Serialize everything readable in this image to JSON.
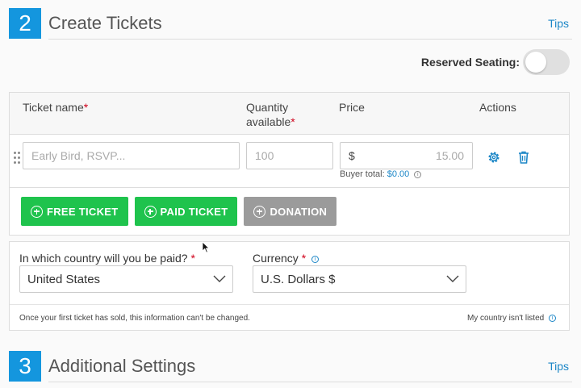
{
  "create": {
    "step": "2",
    "title": "Create Tickets",
    "tips": "Tips"
  },
  "reserved_seating": {
    "label": "Reserved Seating:",
    "enabled": false
  },
  "ticket_table": {
    "columns": {
      "name": "Ticket name",
      "quantity_line1": "Quantity",
      "quantity_line2": "available",
      "price": "Price",
      "actions": "Actions"
    },
    "required_mark": "*",
    "row": {
      "name_placeholder": "Early Bird, RSVP...",
      "quantity_placeholder": "100",
      "currency_symbol": "$",
      "price_placeholder": "15.00",
      "buyer_total_label": "Buyer total:",
      "buyer_total_value": "$0.00"
    },
    "buttons": {
      "free": "FREE TICKET",
      "paid": "PAID TICKET",
      "donation": "DONATION"
    }
  },
  "payment": {
    "country_label": "In which country will you be paid?",
    "country_value": "United States",
    "currency_label": "Currency",
    "currency_value": "U.S. Dollars $",
    "note": "Once your first ticket has sold, this information can't be changed.",
    "not_listed": "My country isn't listed"
  },
  "additional": {
    "step": "3",
    "title": "Additional Settings",
    "tips": "Tips"
  },
  "colors": {
    "accent": "#1496de",
    "green": "#1fc34d",
    "grey_button": "#9b9b9b",
    "link": "#1d87c7",
    "required": "#d0021b"
  }
}
